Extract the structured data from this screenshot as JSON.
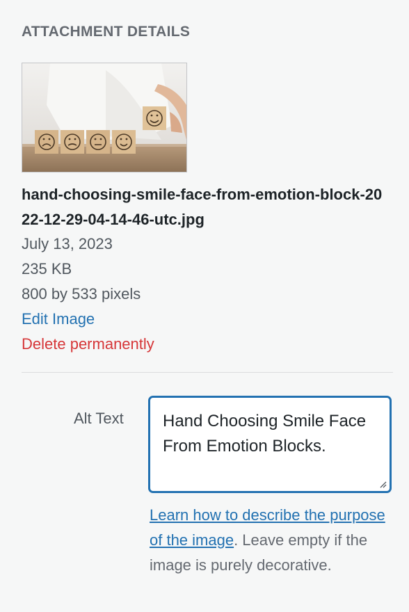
{
  "panel": {
    "heading": "ATTACHMENT DETAILS"
  },
  "attachment": {
    "thumbnail_icon": "photo-hand-choosing-smile-face-blocks",
    "filename": "hand-choosing-smile-face-from-emotion-block-2022-12-29-04-14-46-utc.jpg",
    "date": "July 13, 2023",
    "file_size": "235 KB",
    "dimensions": "800 by 533 pixels",
    "edit_link": "Edit Image",
    "delete_link": "Delete permanently"
  },
  "alt_text": {
    "label": "Alt Text",
    "value": "Hand Choosing Smile Face From Emotion Blocks.",
    "help_link": "Learn how to describe the purpose of the image",
    "help_suffix": ". Leave empty if the image is purely decorative."
  },
  "colors": {
    "link": "#2271b1",
    "delete": "#d63638",
    "focus_border": "#2271b1",
    "background": "#f6f7f7"
  }
}
